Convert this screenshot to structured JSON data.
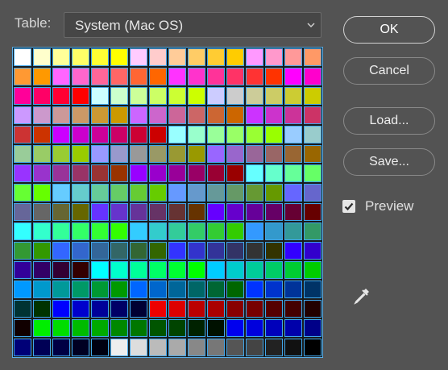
{
  "table_label": "Table:",
  "table_select": {
    "value": "System (Mac OS)"
  },
  "buttons": {
    "ok": "OK",
    "cancel": "Cancel",
    "load": "Load...",
    "save": "Save..."
  },
  "preview": {
    "label": "Preview",
    "checked": true
  },
  "icons": {
    "dropdown": "chevron-down-icon",
    "eyedropper": "eyedropper-icon",
    "check": "checkmark-icon"
  },
  "colors": {
    "background": "#535353",
    "cell_border": "#3fa6ea",
    "swatches": [
      [
        "#ffffff",
        "#ffffcc",
        "#ffff99",
        "#ffff66",
        "#ffff33",
        "#ffff00",
        "#ffccff",
        "#ffcccc",
        "#ffcc99",
        "#ffcc66",
        "#ffcc33",
        "#ffcc00",
        "#ff99ff",
        "#ff99cc",
        "#ff9999",
        "#ff9966"
      ],
      [
        "#ff9933",
        "#ff9900",
        "#ff66ff",
        "#ff66cc",
        "#ff6699",
        "#ff6666",
        "#ff6633",
        "#ff6600",
        "#ff33ff",
        "#ff33cc",
        "#ff3399",
        "#ff3366",
        "#ff3333",
        "#ff3300",
        "#ff00ff",
        "#ff00cc"
      ],
      [
        "#ff0099",
        "#ff0066",
        "#ff0033",
        "#ff0000",
        "#ccffff",
        "#ccffcc",
        "#ccff99",
        "#ccff66",
        "#ccff33",
        "#ccff00",
        "#ccccff",
        "#cccccc",
        "#cccc99",
        "#cccc66",
        "#cccc33",
        "#cccc00"
      ],
      [
        "#cc99ff",
        "#cc99cc",
        "#cc9999",
        "#cc9966",
        "#cc9933",
        "#cc9900",
        "#cc66ff",
        "#cc66cc",
        "#cc6699",
        "#cc6666",
        "#cc6633",
        "#cc6600",
        "#cc33ff",
        "#cc33cc",
        "#cc3399",
        "#cc3366"
      ],
      [
        "#cc3333",
        "#cc3300",
        "#cc00ff",
        "#cc00cc",
        "#cc0099",
        "#cc0066",
        "#cc0033",
        "#cc0000",
        "#99ffff",
        "#99ffcc",
        "#99ff99",
        "#99ff66",
        "#99ff33",
        "#99ff00",
        "#99ccff",
        "#99cccc"
      ],
      [
        "#99cc99",
        "#99cc66",
        "#99cc33",
        "#99cc00",
        "#9999ff",
        "#9999cc",
        "#999999",
        "#999966",
        "#999933",
        "#999900",
        "#9966ff",
        "#9966cc",
        "#996699",
        "#996666",
        "#996633",
        "#996600"
      ],
      [
        "#9933ff",
        "#9933cc",
        "#993399",
        "#993366",
        "#993333",
        "#993300",
        "#9900ff",
        "#9900cc",
        "#990099",
        "#990066",
        "#990033",
        "#990000",
        "#66ffff",
        "#66ffcc",
        "#66ff99",
        "#66ff66"
      ],
      [
        "#66ff33",
        "#66ff00",
        "#66ccff",
        "#66cccc",
        "#66cc99",
        "#66cc66",
        "#66cc33",
        "#66cc00",
        "#6699ff",
        "#6699cc",
        "#669999",
        "#669966",
        "#669933",
        "#669900",
        "#6666ff",
        "#6666cc"
      ],
      [
        "#666699",
        "#666666",
        "#666633",
        "#666600",
        "#6633ff",
        "#6633cc",
        "#663399",
        "#663366",
        "#663333",
        "#663300",
        "#6600ff",
        "#6600cc",
        "#660099",
        "#660066",
        "#660033",
        "#660000"
      ],
      [
        "#33ffff",
        "#33ffcc",
        "#33ff99",
        "#33ff66",
        "#33ff33",
        "#33ff00",
        "#33ccff",
        "#33cccc",
        "#33cc99",
        "#33cc66",
        "#33cc33",
        "#33cc00",
        "#3399ff",
        "#3399cc",
        "#339999",
        "#339966"
      ],
      [
        "#339933",
        "#339900",
        "#3366ff",
        "#3366cc",
        "#336699",
        "#336666",
        "#336633",
        "#336600",
        "#3333ff",
        "#3333cc",
        "#333399",
        "#333366",
        "#333333",
        "#333300",
        "#3300ff",
        "#3300cc"
      ],
      [
        "#330099",
        "#330066",
        "#330033",
        "#330000",
        "#00ffff",
        "#00ffcc",
        "#00ff99",
        "#00ff66",
        "#00ff33",
        "#00ff00",
        "#00ccff",
        "#00cccc",
        "#00cc99",
        "#00cc66",
        "#00cc33",
        "#00cc00"
      ],
      [
        "#0099ff",
        "#0099cc",
        "#009999",
        "#009966",
        "#009933",
        "#009900",
        "#0066ff",
        "#0066cc",
        "#006699",
        "#006666",
        "#006633",
        "#006600",
        "#0033ff",
        "#0033cc",
        "#003399",
        "#003366"
      ],
      [
        "#003333",
        "#003300",
        "#0000ff",
        "#0000cc",
        "#000099",
        "#000066",
        "#000033",
        "#ee0000",
        "#dd0000",
        "#bb0000",
        "#aa0000",
        "#880000",
        "#770000",
        "#550000",
        "#440000",
        "#220000"
      ],
      [
        "#110000",
        "#00ee00",
        "#00dd00",
        "#00bb00",
        "#00aa00",
        "#008800",
        "#007700",
        "#005500",
        "#004400",
        "#002200",
        "#001100",
        "#0000ee",
        "#0000dd",
        "#0000bb",
        "#0000aa",
        "#000088"
      ],
      [
        "#000077",
        "#000055",
        "#000044",
        "#000022",
        "#000011",
        "#eeeeee",
        "#dddddd",
        "#bbbbbb",
        "#aaaaaa",
        "#888888",
        "#777777",
        "#555555",
        "#444444",
        "#222222",
        "#111111",
        "#000000"
      ]
    ]
  }
}
